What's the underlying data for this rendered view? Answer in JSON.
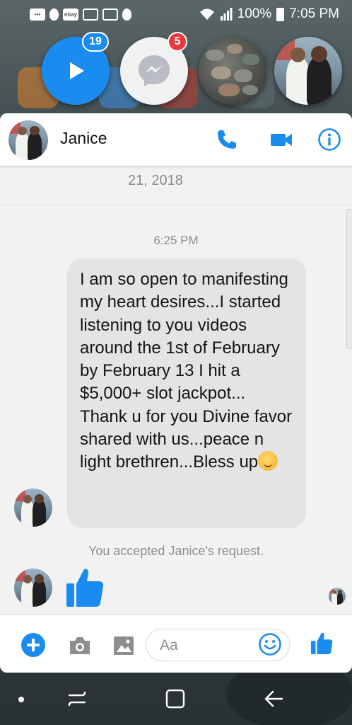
{
  "status_bar": {
    "ebay_label": "ebay",
    "battery_percent": "100%",
    "time": "7:05 PM",
    "icons": [
      "message-icon",
      "flame-icon",
      "ebay-icon",
      "mail-icon",
      "gmail-icon",
      "flame-icon",
      "wifi-icon",
      "signal-icon",
      "battery-icon"
    ]
  },
  "chat_heads": {
    "play": {
      "badge": "19"
    },
    "messenger": {
      "badge": "5"
    }
  },
  "conversation": {
    "contact_name": "Janice",
    "date_fragment": "21, 2018",
    "time_label": "6:25 PM",
    "message_text": "I am so open to manifesting my heart desires...I started listening to you videos around the 1st of February by February 13 I hit a $5,000+ slot jackpot... Thank u for you Divine favor shared with us...peace n light brethren...Bless up",
    "message_emoji": "hugging-face-emoji",
    "system_note": "You accepted Janice's request."
  },
  "composer": {
    "placeholder": "Aa"
  },
  "colors": {
    "accent": "#1a8cf0",
    "badge_red": "#e8373d",
    "bubble": "#e4e4e4"
  }
}
